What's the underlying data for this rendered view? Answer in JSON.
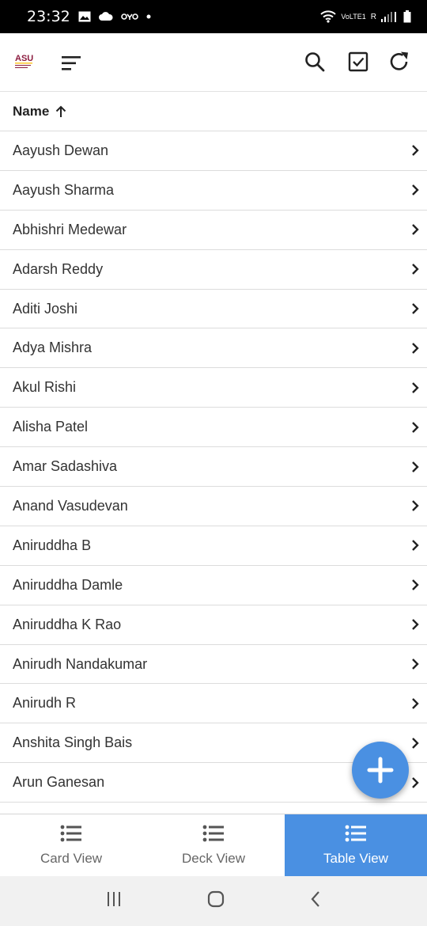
{
  "status": {
    "time": "23:32",
    "carrier_icon": "oyo-icon",
    "network_label": "VoLTE1",
    "signal_label": "R"
  },
  "app_bar": {
    "logo_text": "ASU",
    "logo_icon": "asu-logo-icon",
    "menu_icon": "menu-icon",
    "search_icon": "search-icon",
    "select_icon": "checkbox-icon",
    "refresh_icon": "refresh-icon"
  },
  "table": {
    "column_header": "Name",
    "sort_icon": "arrow-up-icon",
    "rows": [
      "Aayush Dewan",
      "Aayush Sharma",
      "Abhishri Medewar",
      "Adarsh Reddy",
      "Aditi Joshi",
      "Adya Mishra",
      "Akul Rishi",
      "Alisha Patel",
      "Amar Sadashiva",
      "Anand Vasudevan",
      "Aniruddha B",
      "Aniruddha Damle",
      "Aniruddha K Rao",
      "Anirudh Nandakumar",
      "Anirudh R",
      "Anshita Singh Bais",
      "Arun Ganesan"
    ]
  },
  "fab": {
    "icon": "plus-icon",
    "color": "#4a90e2"
  },
  "tabs": [
    {
      "label": "Card View",
      "icon": "list-icon",
      "active": false
    },
    {
      "label": "Deck View",
      "icon": "list-icon",
      "active": false
    },
    {
      "label": "Table View",
      "icon": "list-icon",
      "active": true
    }
  ],
  "colors": {
    "accent": "#4a90e2",
    "divider": "#dcdcdc"
  },
  "nav": {
    "recents_icon": "recents-icon",
    "home_icon": "home-icon",
    "back_icon": "back-icon"
  }
}
